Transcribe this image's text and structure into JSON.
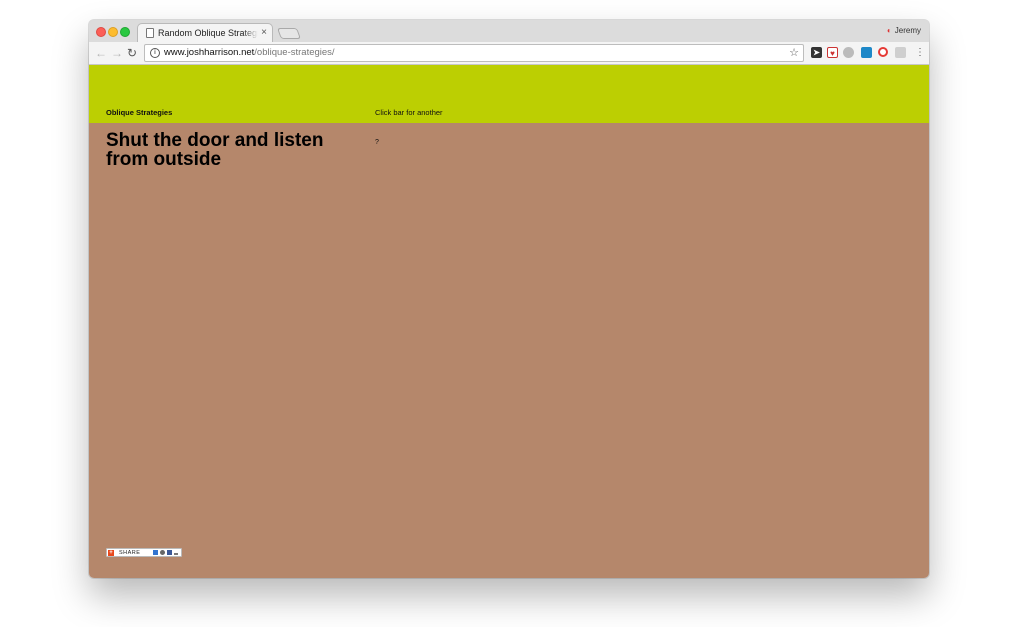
{
  "browser": {
    "tab_title": "Random Oblique Strategies Online",
    "tab_close": "×",
    "profile_name": "Jeremy",
    "url_host": "www.joshharrison.net",
    "url_path": "/oblique-strategies/",
    "icons": {
      "back": "arrow-left-icon",
      "forward": "arrow-right-icon",
      "reload": "reload-icon",
      "info": "info-icon",
      "bookmark": "star-icon",
      "menu": "kebab-menu-icon"
    }
  },
  "page": {
    "site_title": "Oblique Strategies",
    "bar_hint": "Click bar for another",
    "strategy_text": "Shut the door and listen from outside",
    "help_link": "?",
    "share_label": "SHARE",
    "colors": {
      "bar": "#bccf02",
      "content": "#b5876b"
    }
  }
}
